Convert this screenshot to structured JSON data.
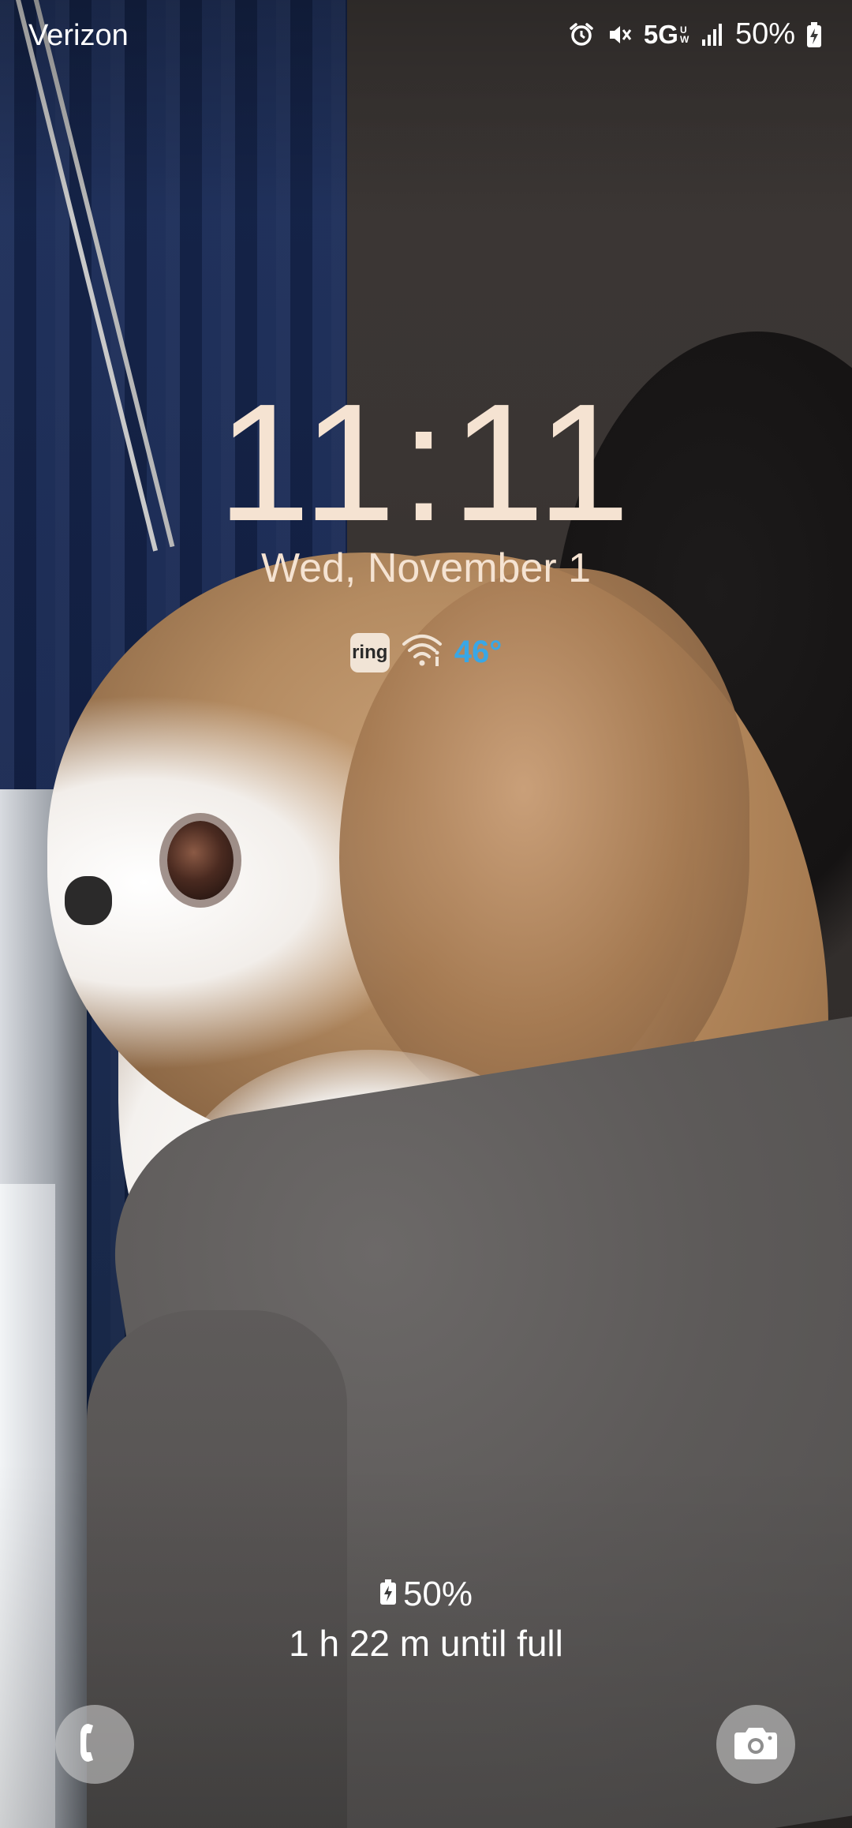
{
  "status_bar": {
    "carrier": "Verizon",
    "network": "5G",
    "network_sub": "UW",
    "battery": "50%",
    "icons": [
      "alarm-icon",
      "mute-icon",
      "signal-icon",
      "battery-charging-icon"
    ]
  },
  "lock_screen": {
    "time": "11:11",
    "date": "Wed, November 1",
    "widgets": {
      "ring_label": "ring",
      "wifi_icon": "wifi-icon",
      "temperature": "46°"
    },
    "charging": {
      "percent": "50%",
      "status": "1 h 22 m until full"
    },
    "shortcuts": {
      "left": "phone-icon",
      "right": "camera-icon"
    }
  },
  "colors": {
    "clock": "#f5e3d2",
    "temperature": "#39a7e6",
    "shortcut_bg": "#d7d7d7"
  }
}
